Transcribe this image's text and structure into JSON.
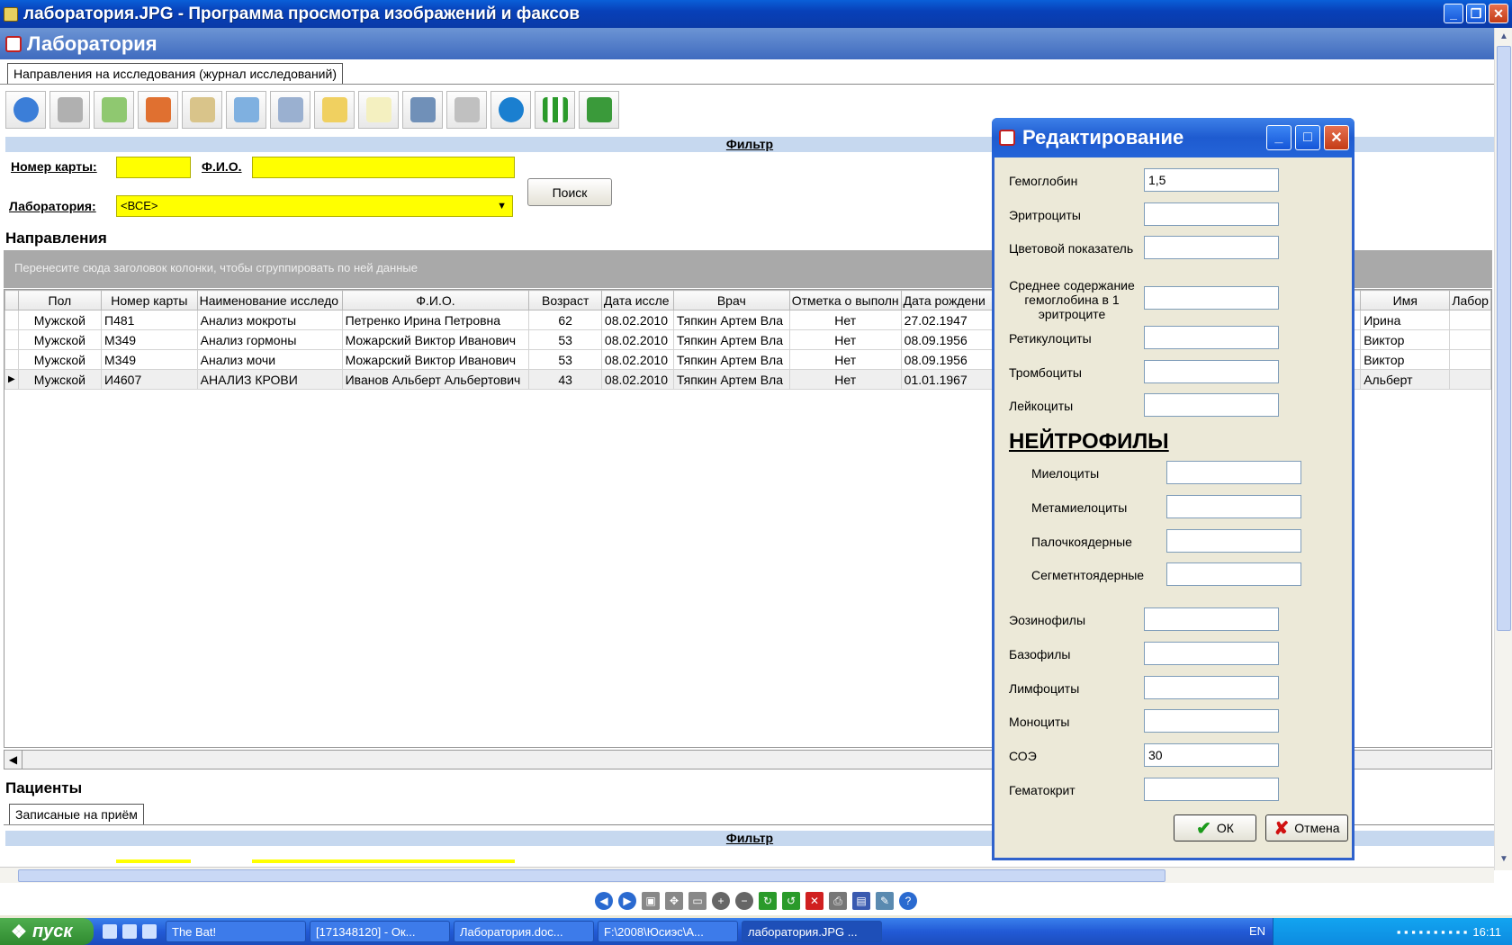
{
  "window": {
    "title": "лаборатория.JPG - Программа просмотра изображений и факсов"
  },
  "app": {
    "title": "Лаборатория",
    "tab": "Направления на исследования (журнал исследований)",
    "filter_label": "Фильтр",
    "filter": {
      "card_label": "Номер карты:",
      "card_value": "",
      "fio_label": "Ф.И.О.",
      "fio_value": "",
      "lab_label": "Лаборатория:",
      "lab_value": "<ВСЕ>",
      "search_button": "Поиск"
    },
    "directions_title": "Направления",
    "group_hint": "Перенесите сюда заголовок колонки, чтобы сгруппировать по ней данные",
    "columns": [
      "Пол",
      "Номер карты",
      "Наименование исследо",
      "Ф.И.О.",
      "Возраст",
      "Дата иссле",
      "Врач",
      "Отметка о выполн",
      "Дата рождени",
      "Имя",
      "Лабор"
    ],
    "rows": [
      [
        "Мужской",
        "П481",
        "Анализ мокроты",
        "Петренко Ирина Петровна",
        "62",
        "08.02.2010",
        "Тяпкин Артем Вла",
        "Нет",
        "27.02.1947",
        "Ирина",
        ""
      ],
      [
        "Мужской",
        "М349",
        "Анализ гормоны",
        "Можарский Виктор Иванович",
        "53",
        "08.02.2010",
        "Тяпкин Артем Вла",
        "Нет",
        "08.09.1956",
        "Виктор",
        ""
      ],
      [
        "Мужской",
        "М349",
        "Анализ мочи",
        "Можарский Виктор Иванович",
        "53",
        "08.02.2010",
        "Тяпкин Артем Вла",
        "Нет",
        "08.09.1956",
        "Виктор",
        ""
      ],
      [
        "Мужской",
        "И4607",
        "АНАЛИЗ КРОВИ",
        "Иванов Альберт Альбертович",
        "43",
        "08.02.2010",
        "Тяпкин Артем Вла",
        "Нет",
        "01.01.1967",
        "Альберт",
        ""
      ]
    ],
    "patients_title": "Пациенты",
    "patients_tab": "Записаные на приём",
    "patients_filter_label": "Фильтр"
  },
  "dialog": {
    "title": "Редактирование",
    "fields_top": [
      {
        "label": "Гемоглобин",
        "value": "1,5"
      },
      {
        "label": "Эритроциты",
        "value": ""
      },
      {
        "label": "Цветовой показатель",
        "value": ""
      },
      {
        "label": "Среднее содержание гемоглобина в 1 эритроците",
        "value": ""
      },
      {
        "label": "Ретикулоциты",
        "value": ""
      },
      {
        "label": "Тромбоциты",
        "value": ""
      },
      {
        "label": "Лейкоциты",
        "value": ""
      }
    ],
    "neutrophils_heading": "НЕЙТРОФИЛЫ",
    "fields_neutro": [
      {
        "label": "Миелоциты",
        "value": ""
      },
      {
        "label": "Метамиелоциты",
        "value": ""
      },
      {
        "label": "Палочкоядерные",
        "value": ""
      },
      {
        "label": "Сегметнтоядерные",
        "value": ""
      }
    ],
    "fields_bottom": [
      {
        "label": "Эозинофилы",
        "value": ""
      },
      {
        "label": "Базофилы",
        "value": ""
      },
      {
        "label": "Лимфоциты",
        "value": ""
      },
      {
        "label": "Моноциты",
        "value": ""
      },
      {
        "label": "СОЭ",
        "value": "30"
      },
      {
        "label": "Гематокрит",
        "value": ""
      }
    ],
    "ok_label": "ОК",
    "cancel_label": "Отмена"
  },
  "taskbar": {
    "start_label": "пуск",
    "tasks": [
      "The Bat!",
      "[171348120] - Ок...",
      "Лаборатория.doc...",
      "F:\\2008\\Юсиэс\\А...",
      "лаборатория.JPG ..."
    ],
    "lang": "EN",
    "clock": "16:11"
  },
  "colors": {
    "accent": "#0a5fd8",
    "field_highlight": "#ffff00",
    "filter_bar": "#c6d8ef"
  }
}
